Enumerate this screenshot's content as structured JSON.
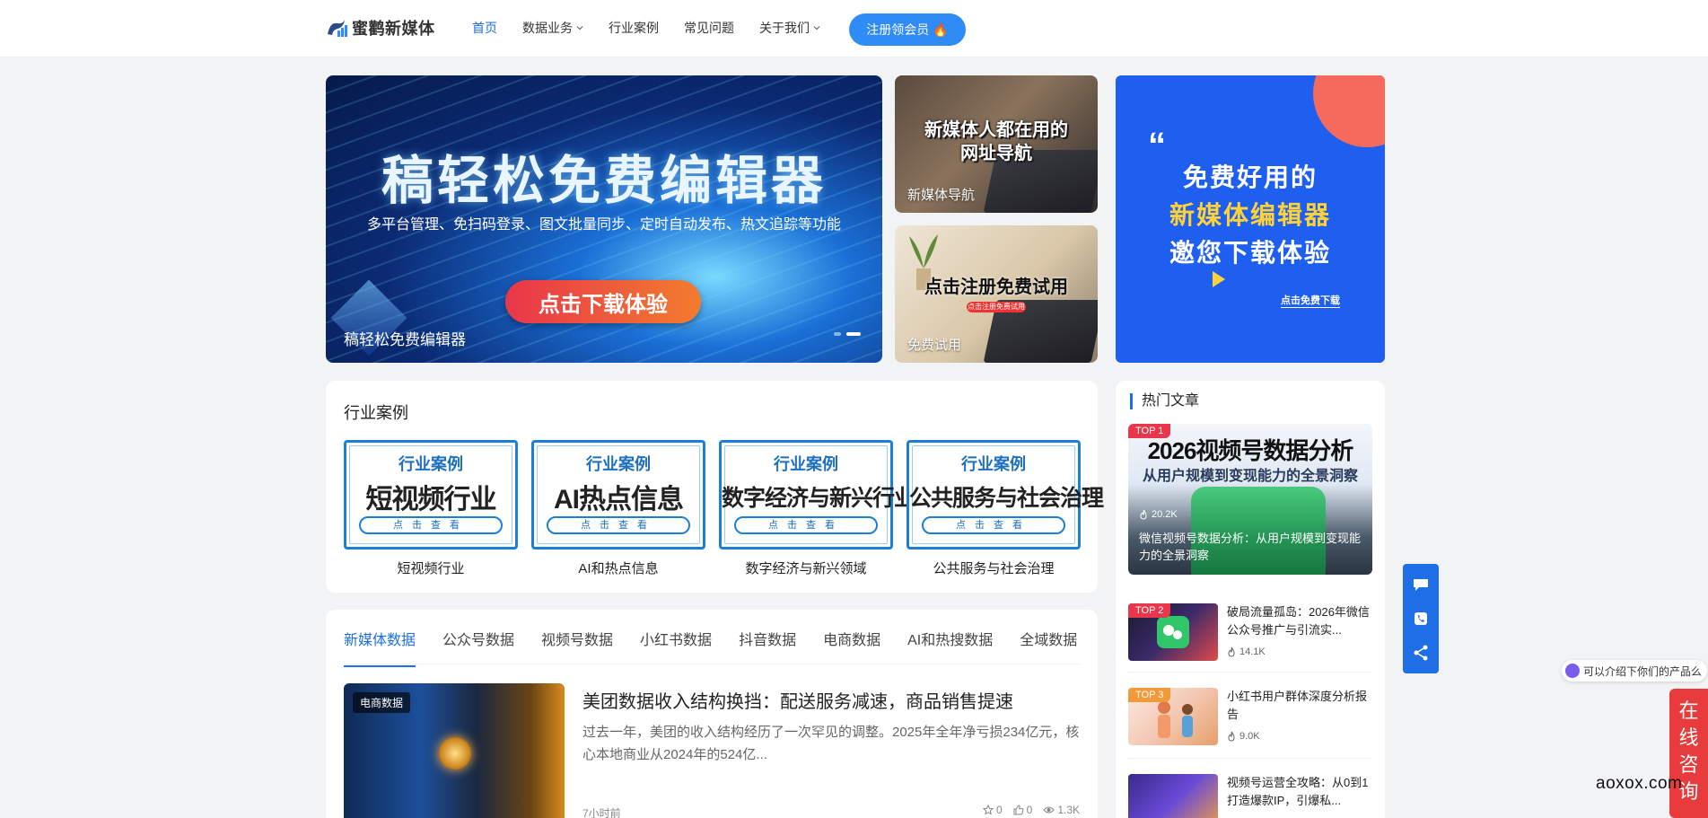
{
  "header": {
    "logo_text": "蜜鹳新媒体",
    "nav": [
      {
        "label": "首页",
        "active": true,
        "dropdown": false
      },
      {
        "label": "数据业务",
        "active": false,
        "dropdown": true
      },
      {
        "label": "行业案例",
        "active": false,
        "dropdown": false
      },
      {
        "label": "常见问题",
        "active": false,
        "dropdown": false
      },
      {
        "label": "关于我们",
        "active": false,
        "dropdown": true
      }
    ],
    "register_label": "注册领会员",
    "register_emoji": "🔥",
    "accent_color": "#1e6fe6"
  },
  "banners": {
    "main": {
      "title": "稿轻松免费编辑器",
      "subtitle": "多平台管理、免扫码登录、图文批量同步、定时自动发布、热文追踪等功能",
      "button": "点击下载体验",
      "caption": "稿轻松免费编辑器"
    },
    "nav_banner": {
      "line1": "新媒体人都在用的",
      "line2": "网址导航",
      "caption": "新媒体导航"
    },
    "trial_banner": {
      "title": "点击注册免费试用",
      "badge": "点击注册免费试用",
      "caption": "免费试用"
    },
    "right_banner": {
      "quote": "“",
      "line1": "免费好用的",
      "line2": "新媒体编辑器",
      "line3": "邀您下载体验",
      "link": "点击免费下载"
    }
  },
  "cases": {
    "title": "行业案例",
    "tag": "行业案例",
    "check": "点击查看",
    "items": [
      {
        "name": "短视频行业",
        "label": "短视频行业"
      },
      {
        "name": "AI热点信息",
        "label": "AI和热点信息"
      },
      {
        "name": "数字经济与新兴行业",
        "label": "数字经济与新兴领域"
      },
      {
        "name": "公共服务与社会治理",
        "label": "公共服务与社会治理"
      }
    ]
  },
  "news": {
    "tabs": [
      "新媒体数据",
      "公众号数据",
      "视频号数据",
      "小红书数据",
      "抖音数据",
      "电商数据",
      "AI和热搜数据",
      "全域数据"
    ],
    "active_tab": 0,
    "article": {
      "badge": "电商数据",
      "title": "美团数据收入结构换挡：配送服务减速，商品销售提速",
      "desc": "过去一年，美团的收入结构经历了一次罕见的调整。2025年全年净亏损234亿元，核心本地商业从2024年的524亿...",
      "time": "7小时前",
      "stars": "0",
      "likes": "0",
      "views": "1.3K"
    }
  },
  "hot": {
    "title": "热门文章",
    "top1": {
      "badge": "TOP 1",
      "headline": "2026视频号数据分析",
      "subheadline": "从用户规模到变现能力的全景洞察",
      "views": "20.2K",
      "caption": "微信视频号数据分析：从用户规模到变现能力的全景洞察"
    },
    "items": [
      {
        "badge": "TOP 2",
        "title": "破局流量孤岛：2026年微信公众号推广与引流实...",
        "views": "14.1K"
      },
      {
        "badge": "TOP 3",
        "title": "小红书用户群体深度分析报告",
        "views": "9.0K"
      },
      {
        "badge": "",
        "title": "视频号运营全攻略：从0到1打造爆款IP，引爆私...",
        "views": ""
      }
    ]
  },
  "widgets": {
    "bot_hint": "可以介绍下你们的产品么",
    "consult": "在线咨询",
    "watermark": "aoxox.com"
  }
}
